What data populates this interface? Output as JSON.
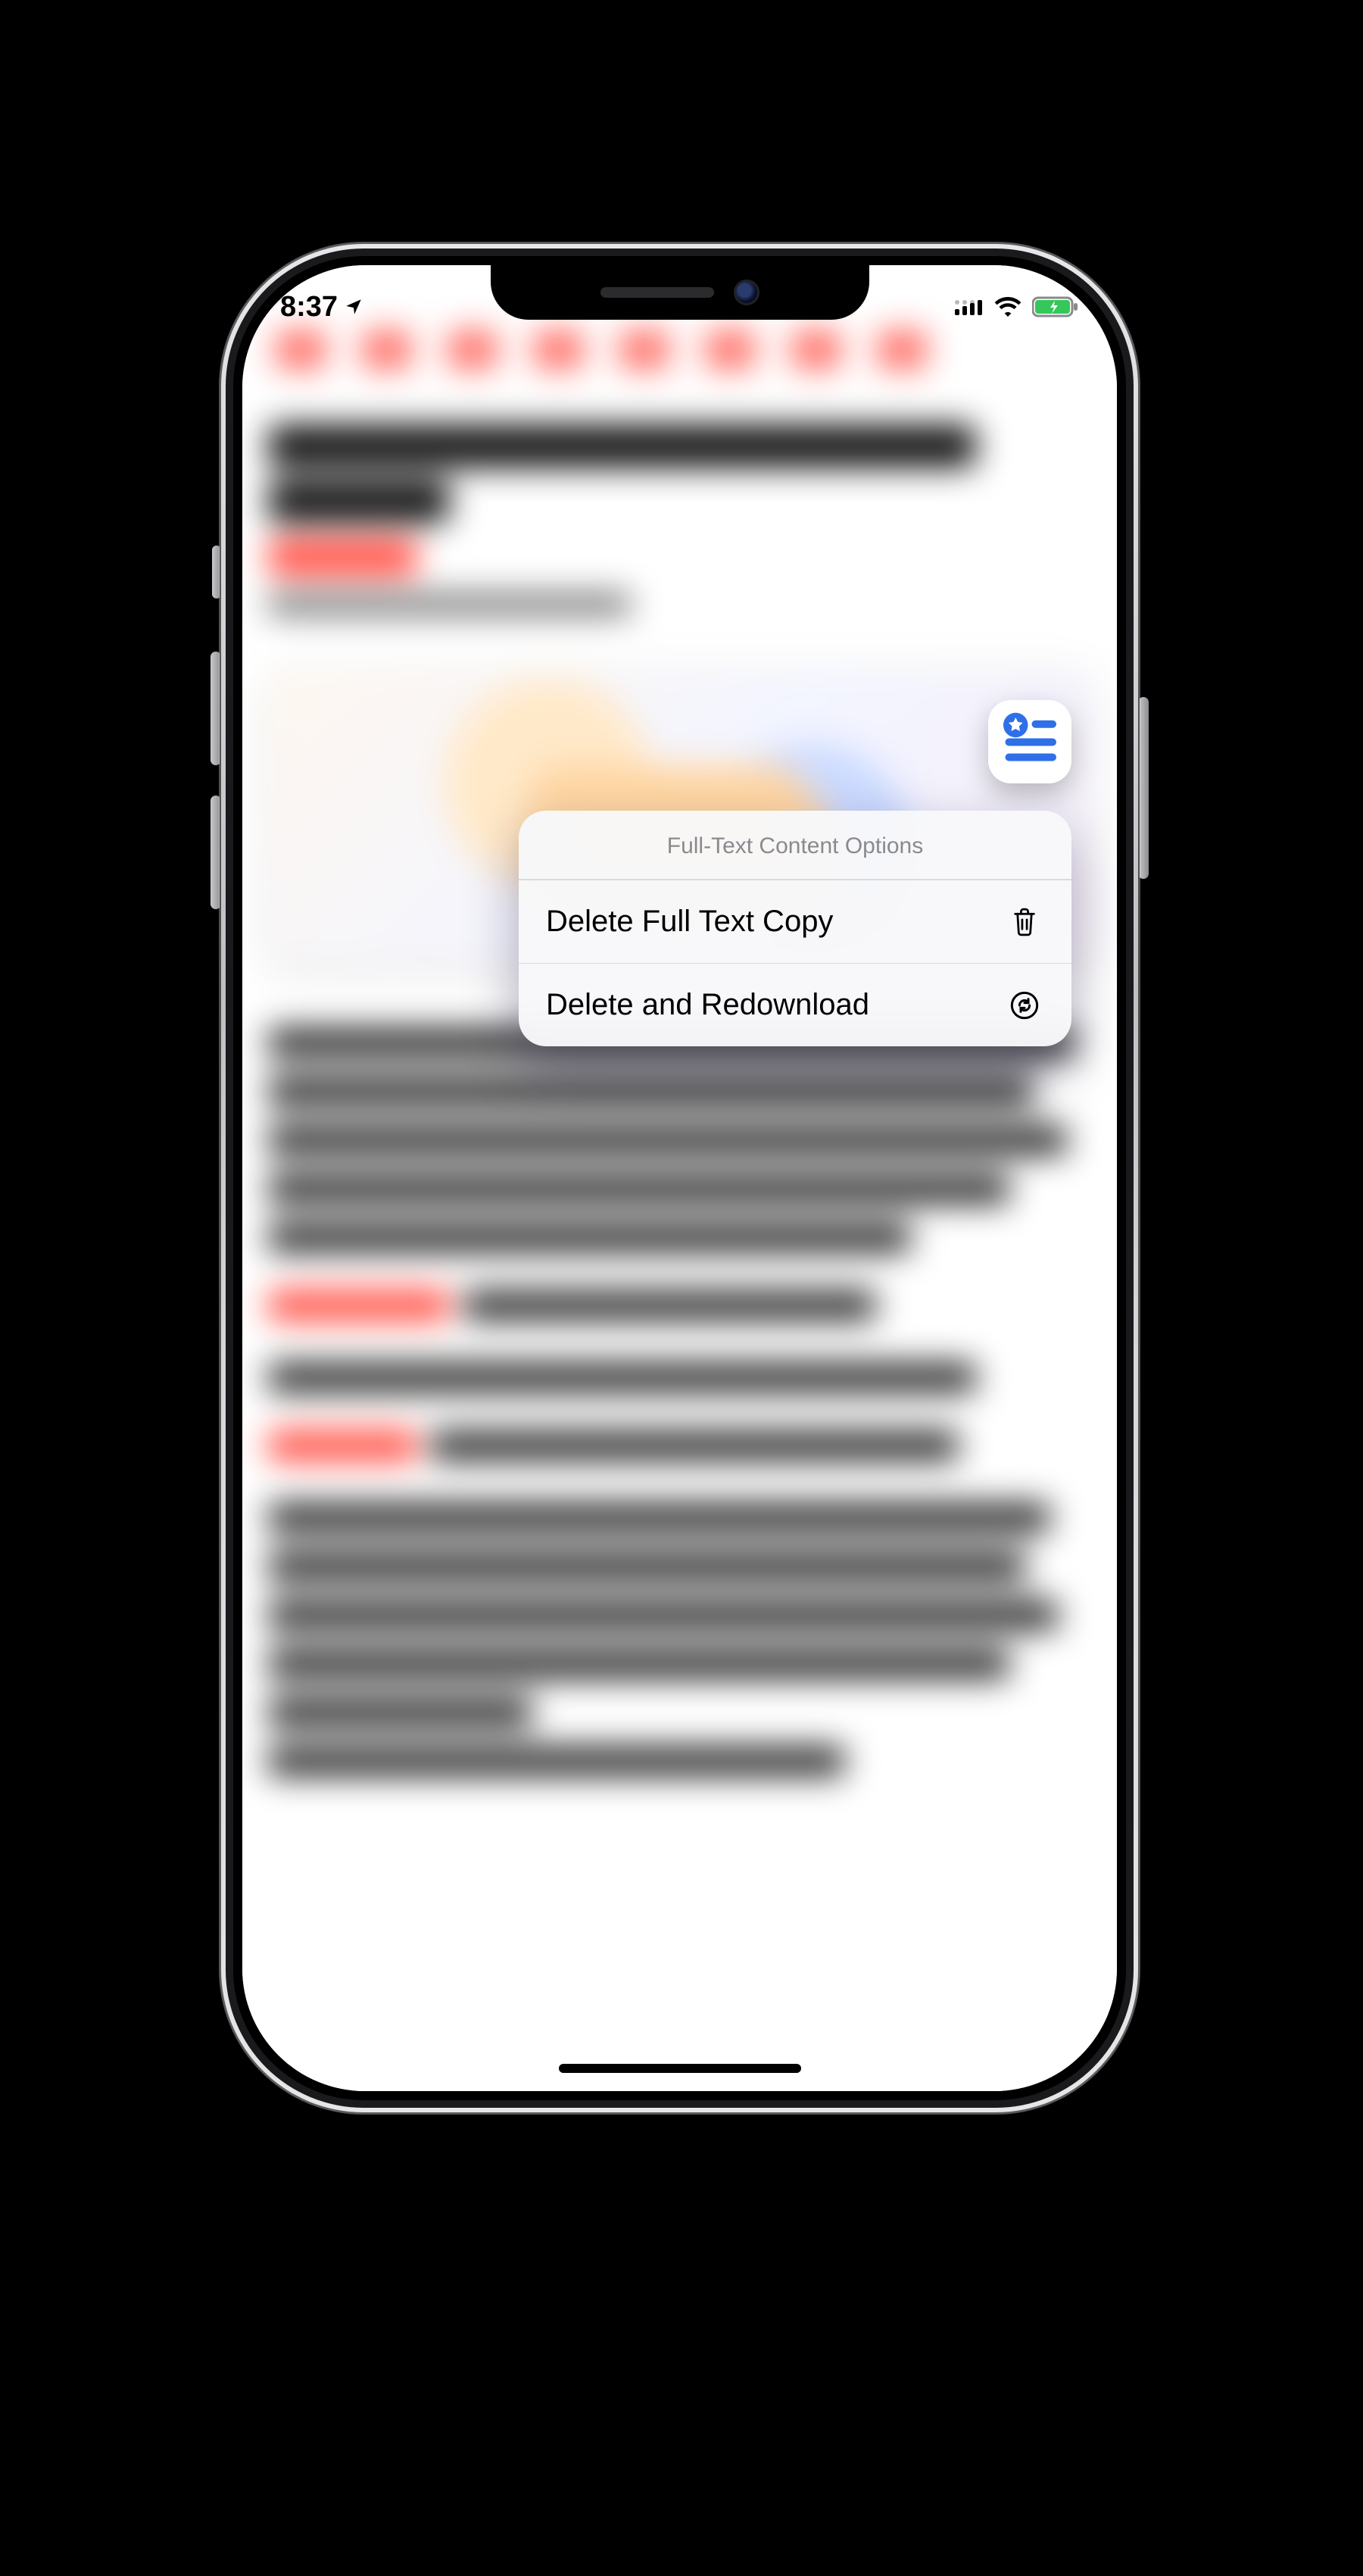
{
  "statusbar": {
    "time": "8:37"
  },
  "reader_badge": {
    "icon_name": "star-list-icon"
  },
  "context_menu": {
    "title": "Full-Text Content Options",
    "items": [
      {
        "label": "Delete Full Text Copy",
        "icon": "trash"
      },
      {
        "label": "Delete and Redownload",
        "icon": "refresh"
      }
    ]
  }
}
